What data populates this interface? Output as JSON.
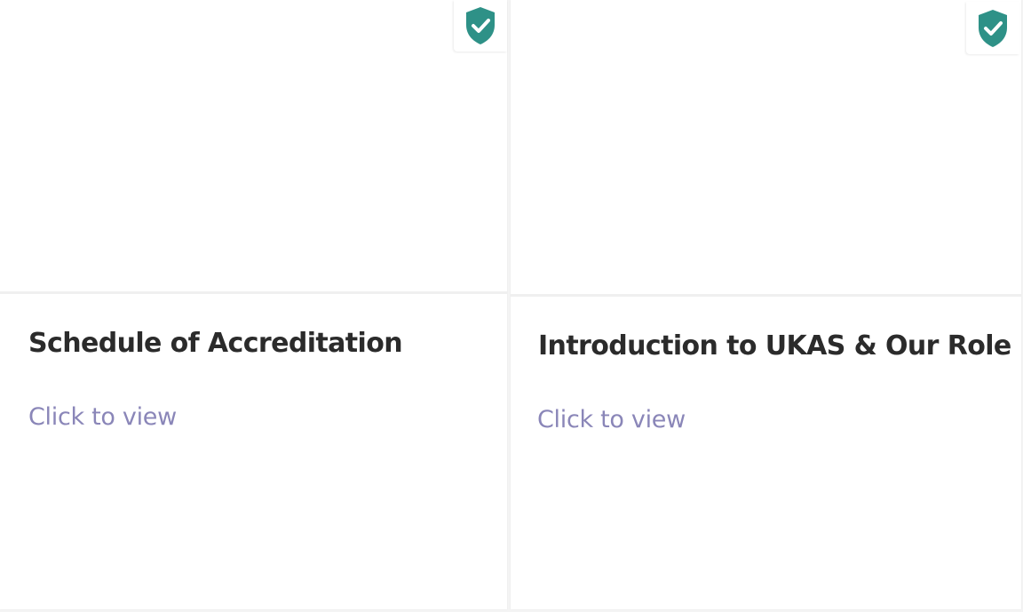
{
  "cards": [
    {
      "title": "Schedule of Accreditation",
      "link_label": "Click to view",
      "badge_icon": "shield-check-icon"
    },
    {
      "title": "Introduction to UKAS & Our Role",
      "link_label": "Click to view",
      "badge_icon": "shield-check-icon"
    }
  ],
  "colors": {
    "shield": "#2e9187",
    "link": "#8a86b8",
    "title": "#2b2b2b"
  }
}
